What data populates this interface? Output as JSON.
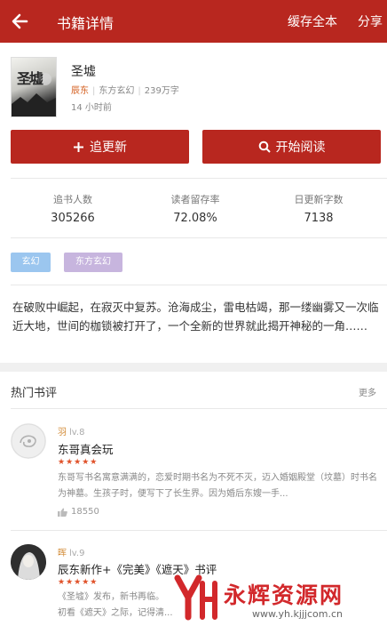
{
  "header": {
    "title": "书籍详情",
    "cache_label": "缓存全本",
    "share_label": "分享"
  },
  "book": {
    "title": "圣墟",
    "author": "辰东",
    "category": "东方玄幻",
    "word_count": "239万字",
    "updated": "14 小时前",
    "cover_text": "圣墟"
  },
  "actions": {
    "follow_label": "追更新",
    "read_label": "开始阅读"
  },
  "stats": [
    {
      "label": "追书人数",
      "value": "305266"
    },
    {
      "label": "读者留存率",
      "value": "72.08%"
    },
    {
      "label": "日更新字数",
      "value": "7138"
    }
  ],
  "tags": [
    "玄幻",
    "东方玄幻"
  ],
  "description": "在破败中崛起，在寂灭中复苏。沧海成尘，雷电枯竭，那一缕幽雾又一次临近大地，世间的枷锁被打开了，一个全新的世界就此揭开神秘的一角……",
  "reviews_section": {
    "title": "热门书评",
    "more_label": "更多"
  },
  "reviews": [
    {
      "user": "羽",
      "level": "lv.8",
      "title": "东哥真会玩",
      "stars": "★★★★★",
      "body": "东哥写书名寓意满满的，恋爱时期书名为不死不灭，迈入婚姻殿堂（坟墓）时书名为神墓。生孩子时，便写下了长生界。因为婚后东嫂一手...",
      "likes": "18550"
    },
    {
      "user": "晖",
      "level": "lv.9",
      "title": "辰东新作+《完美》《遮天》书评",
      "stars": "★★★★★",
      "body_line1": "《圣墟》发布，新书再临。",
      "body_line2": "初看《遮天》之际，记得清..."
    }
  ],
  "watermark": {
    "brand": "永辉资源网",
    "url": "www.yh.kjjjcom.cn"
  },
  "colors": {
    "primary": "#b8271f",
    "author": "#d35b1a",
    "tag_blue": "#9bc6ef",
    "tag_purple": "#c7b5de",
    "star": "#e0522a"
  }
}
